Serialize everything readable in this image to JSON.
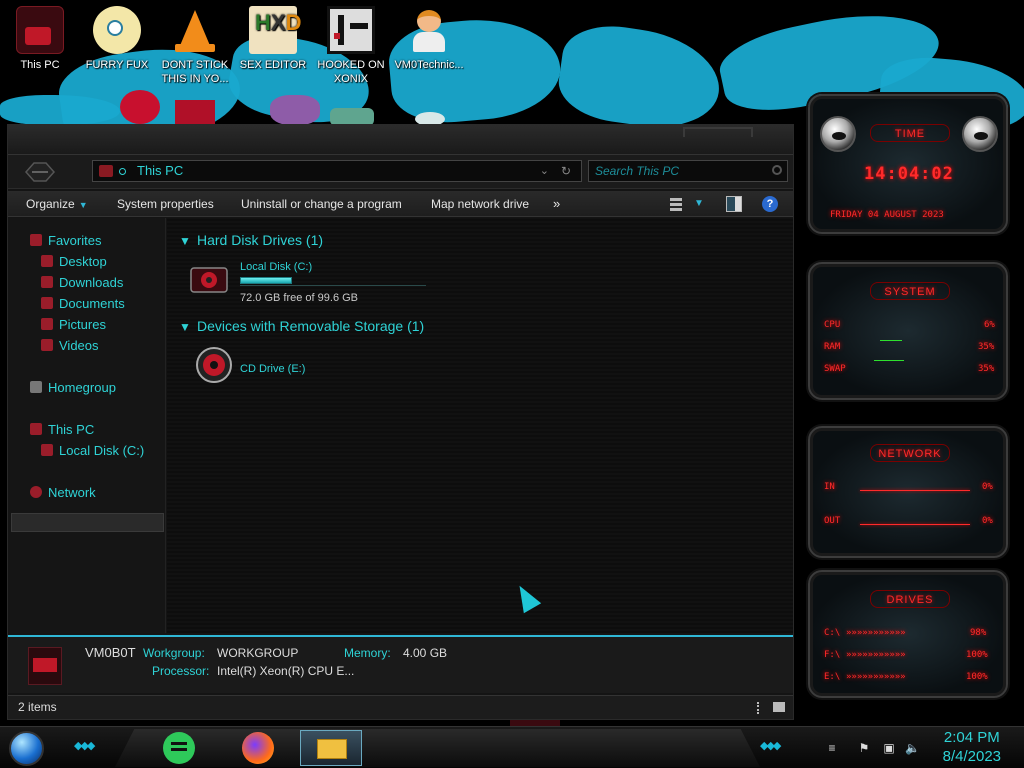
{
  "desktop_icons": [
    {
      "label": "This PC",
      "icon": "this-pc-icon"
    },
    {
      "label": "FURRY FUX",
      "icon": "anime-avatar-icon"
    },
    {
      "label": "DONT STICK THIS IN YO...",
      "icon": "vlc-icon"
    },
    {
      "label": "SEX EDITOR",
      "icon": "hxd-icon"
    },
    {
      "label": "HOOKED ON XONIX",
      "icon": "game-icon"
    },
    {
      "label": "VM0Technic...",
      "icon": "doctor-icon"
    }
  ],
  "explorer": {
    "address": "This PC",
    "search_placeholder": "Search This PC",
    "toolbar": {
      "organize": "Organize",
      "system_properties": "System properties",
      "uninstall": "Uninstall or change a program",
      "map_drive": "Map network drive",
      "more": "»"
    },
    "sidebar": {
      "favorites": "Favorites",
      "desktop": "Desktop",
      "downloads": "Downloads",
      "documents": "Documents",
      "pictures": "Pictures",
      "videos": "Videos",
      "homegroup": "Homegroup",
      "this_pc": "This PC",
      "local_disk": "Local Disk (C:)",
      "network": "Network"
    },
    "groups": {
      "hard_disk": "Hard Disk Drives (1)",
      "removable": "Devices with Removable Storage (1)"
    },
    "drives": {
      "c_name": "Local Disk (C:)",
      "c_free": "72.0 GB free of 99.6 GB",
      "c_used_fraction": 0.277,
      "e_name": "CD Drive (E:)"
    },
    "details": {
      "pc_name": "VM0B0T",
      "workgroup_label": "Workgroup:",
      "workgroup_value": "WORKGROUP",
      "memory_label": "Memory:",
      "memory_value": "4.00 GB",
      "processor_label": "Processor:",
      "processor_value": "Intel(R) Xeon(R) CPU E..."
    },
    "status": "2 items"
  },
  "gadgets": {
    "time_title": "TIME",
    "time_value": "14:04:02",
    "date_value": "FRIDAY 04 AUGUST 2023",
    "system_title": "SYSTEM",
    "cpu_label": "CPU",
    "cpu_value": "6%",
    "ram_label": "RAM",
    "ram_value": "35%",
    "swap_label": "SWAP",
    "swap_value": "35%",
    "network_title": "NETWORK",
    "in_label": "IN",
    "in_value": "0%",
    "out_label": "OUT",
    "out_value": "0%",
    "drives_title": "DRIVES",
    "d1_label": "C:\\",
    "d1_value": "98%",
    "d2_label": "F:\\",
    "d2_value": "100%",
    "d3_label": "E:\\",
    "d3_value": "100%"
  },
  "taskbar": {
    "time": "2:04 PM",
    "date": "8/4/2023",
    "apps": [
      "spotify-like-icon",
      "firefox-icon",
      "file-explorer-icon"
    ]
  },
  "colors": {
    "accent_cyan": "#2fd3d6",
    "alert_red": "#ff2a2a",
    "wallpaper_blue": "#19a9cf"
  }
}
